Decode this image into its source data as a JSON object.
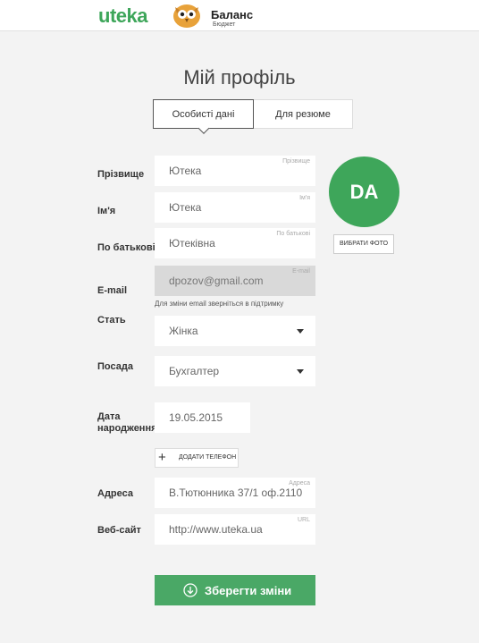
{
  "header": {
    "uteka_logo": "uteka",
    "balans_name": "Баланс",
    "balans_sub": "Бюджет"
  },
  "page": {
    "title": "Мій профіль"
  },
  "tabs": {
    "personal": "Особисті дані",
    "resume": "Для резюме"
  },
  "form": {
    "surname": {
      "label": "Прізвище",
      "value": "Ютека",
      "hint": "Прізвище"
    },
    "name": {
      "label": "Ім'я",
      "value": "Ютека",
      "hint": "Ім'я"
    },
    "patronymic": {
      "label": "По батькові",
      "value": "Ютеківна",
      "hint": "По батькові"
    },
    "email": {
      "label": "E-mail",
      "value": "dpozov@gmail.com",
      "hint": "E-mail",
      "note": "Для зміни email зверніться в підтримку"
    },
    "gender": {
      "label": "Стать",
      "value": "Жінка"
    },
    "position": {
      "label": "Посада",
      "value": "Бухгалтер"
    },
    "birthdate": {
      "label_line1": "Дата",
      "label_line2": "народження",
      "value": "19.05.2015"
    },
    "add_phone": "ДОДАТИ ТЕЛЕФОН",
    "address": {
      "label": "Адреса",
      "value": "В.Тютюнника 37/1 оф.2110",
      "hint": "Адреса"
    },
    "website": {
      "label": "Веб-сайт",
      "value": "http://www.uteka.ua",
      "hint": "URL"
    },
    "save": "Зберегти зміни"
  },
  "avatar": {
    "initials": "DA",
    "choose_photo": "ВИБРАТИ ФОТО"
  },
  "colors": {
    "accent": "#3ea65a",
    "button": "#4aa866",
    "background": "#f3f3f3"
  }
}
